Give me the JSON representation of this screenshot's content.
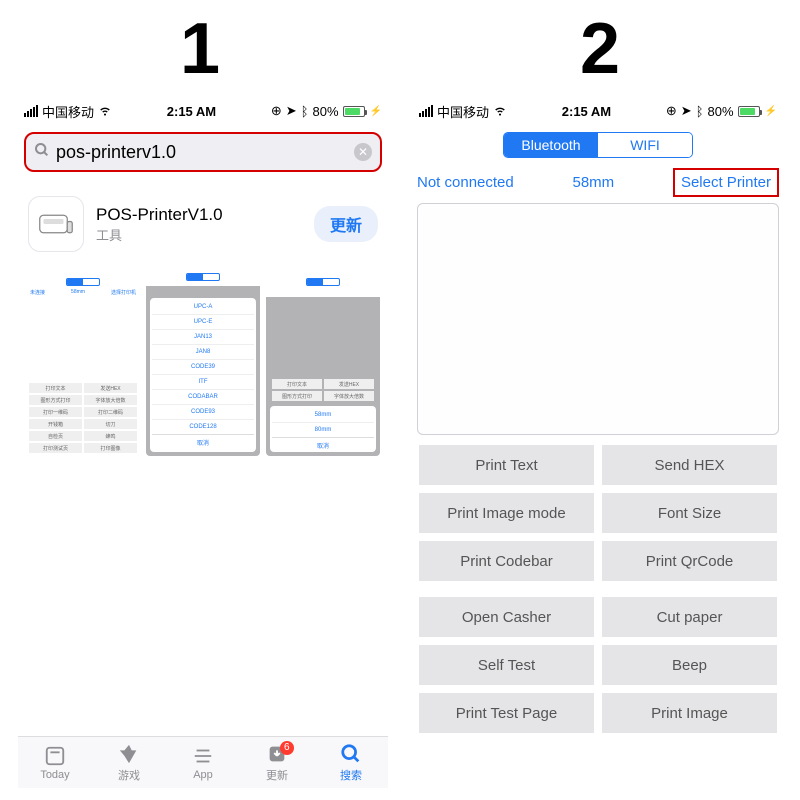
{
  "steps": {
    "one": "1",
    "two": "2"
  },
  "status": {
    "carrier": "中国移动",
    "time": "2:15 AM",
    "battery_pct": "80%"
  },
  "panel1": {
    "search_query": "pos-printerv1.0",
    "result": {
      "name": "POS-PrinterV1.0",
      "category": "工具",
      "action": "更新"
    },
    "thumb1": {
      "sub_l": "未连接",
      "sub_m": "58mm",
      "sub_r": "选择打印机",
      "btns": [
        "打印文本",
        "发送HEX",
        "图形方式打印",
        "字体放大倍数",
        "打印一维码",
        "打印二维码",
        "开钱箱",
        "切刀",
        "自检页",
        "蜂鸣",
        "打印测试页",
        "打印图像"
      ]
    },
    "thumb2": {
      "opts": [
        "UPC-A",
        "UPC-E",
        "JAN13",
        "JAN8",
        "CODE39",
        "ITF",
        "CODABAR",
        "CODE93",
        "CODE128"
      ],
      "cancel": "取消"
    },
    "thumb3": {
      "btns": [
        "打印文本",
        "发送HEX",
        "图形方式打印",
        "字体放大倍数"
      ],
      "opts": [
        "58mm",
        "80mm"
      ],
      "cancel": "取消"
    },
    "tabs": {
      "today": "Today",
      "games": "游戏",
      "app": "App",
      "updates": "更新",
      "search": "搜索",
      "badge": "6"
    }
  },
  "panel2": {
    "seg": {
      "bt": "Bluetooth",
      "wifi": "WIFI"
    },
    "sub": {
      "left": "Not connected",
      "mid": "58mm",
      "right": "Select Printer"
    },
    "grid1": [
      "Print Text",
      "Send HEX",
      "Print Image mode",
      "Font Size",
      "Print Codebar",
      "Print QrCode"
    ],
    "grid2": [
      "Open Casher",
      "Cut paper",
      "Self Test",
      "Beep",
      "Print Test Page",
      "Print Image"
    ]
  }
}
